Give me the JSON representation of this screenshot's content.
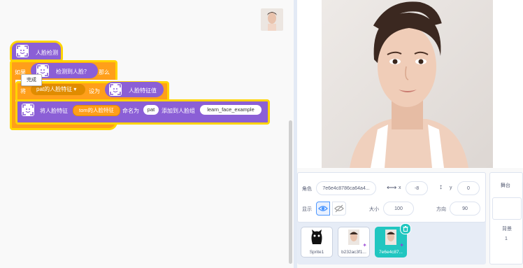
{
  "blocks": {
    "hat_label": "人脸检测",
    "if_label": "如果",
    "then_label": "那么",
    "condition_label": "检测到人脸？",
    "tooltip": "完成",
    "set_label": "将",
    "set_dropdown": "pat的人脸特征 ▾",
    "set_to": "设为",
    "reporter_label": "人脸特征值",
    "add_label": "将人脸特征",
    "add_param": "tom的人脸特征",
    "name_as": "命名为",
    "name_value": "pat",
    "add_to_group": "添加到人脸组",
    "group_value": "learn_face_example"
  },
  "sprite_info": {
    "sprite_label": "角色",
    "sprite_name": "7e6e4c8786ca64a4...",
    "x_icon": "horizontal-arrows-icon",
    "x_label": "x",
    "x_value": "-8",
    "y_icon": "vertical-arrows-icon",
    "y_label": "y",
    "y_value": "0",
    "show_label": "显示",
    "size_label": "大小",
    "size_value": "100",
    "direction_label": "方向",
    "direction_value": "90"
  },
  "sprites": [
    {
      "name": "Sprite1"
    },
    {
      "name": "b232ac3f1..."
    },
    {
      "name": "7e6e4c87..."
    }
  ],
  "stage_panel": {
    "title": "舞台",
    "backdrop_label": "背景",
    "backdrop_count": "1"
  },
  "colors": {
    "motion_purple": "#8b5fd6",
    "control_orange": "#ff9f1a",
    "highlight_yellow": "#ffd400",
    "selection_teal": "#21c6c0",
    "eye_active_blue": "#4c97ff"
  }
}
